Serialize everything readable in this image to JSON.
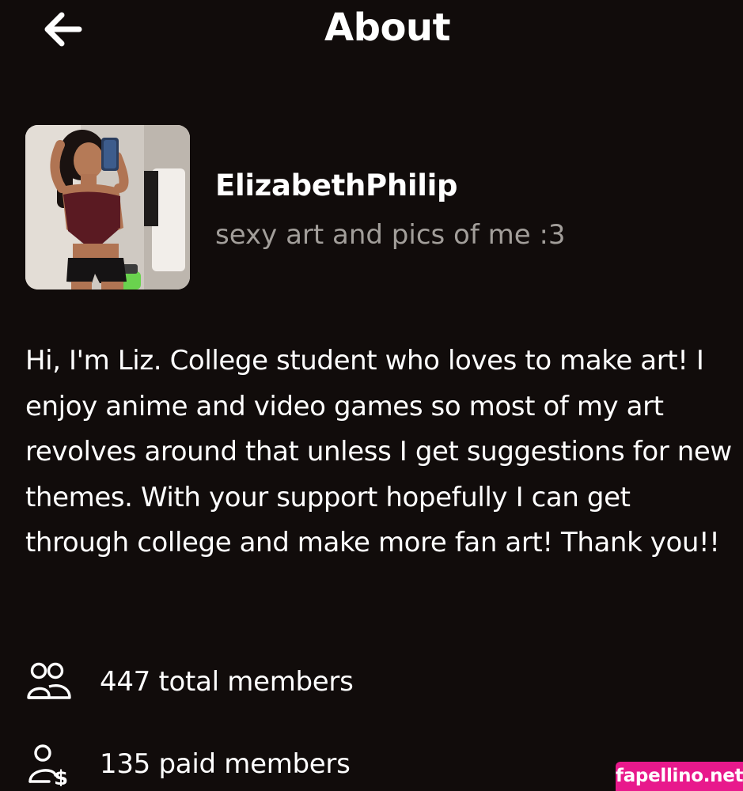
{
  "header": {
    "title": "About",
    "back_icon": "arrow-left-icon"
  },
  "creator": {
    "name": "ElizabethPhilip",
    "tagline": "sexy art and pics of me :3",
    "avatar_icon": "profile-photo"
  },
  "bio": "Hi, I'm Liz. College student who loves to make art! I enjoy anime and video games so most of my art revolves around that unless I get suggestions for new themes. With your support hopefully I can get through college and make more fan art! Thank you!!",
  "stats": [
    {
      "icon": "members-icon",
      "text": "447 total members"
    },
    {
      "icon": "paid-members-icon",
      "text": "135 paid members"
    }
  ],
  "watermark": "fapellino.net",
  "colors": {
    "background": "#110c0b",
    "text": "#ffffff",
    "muted_text": "#a29e9a",
    "watermark_bg": "#e8198c"
  }
}
